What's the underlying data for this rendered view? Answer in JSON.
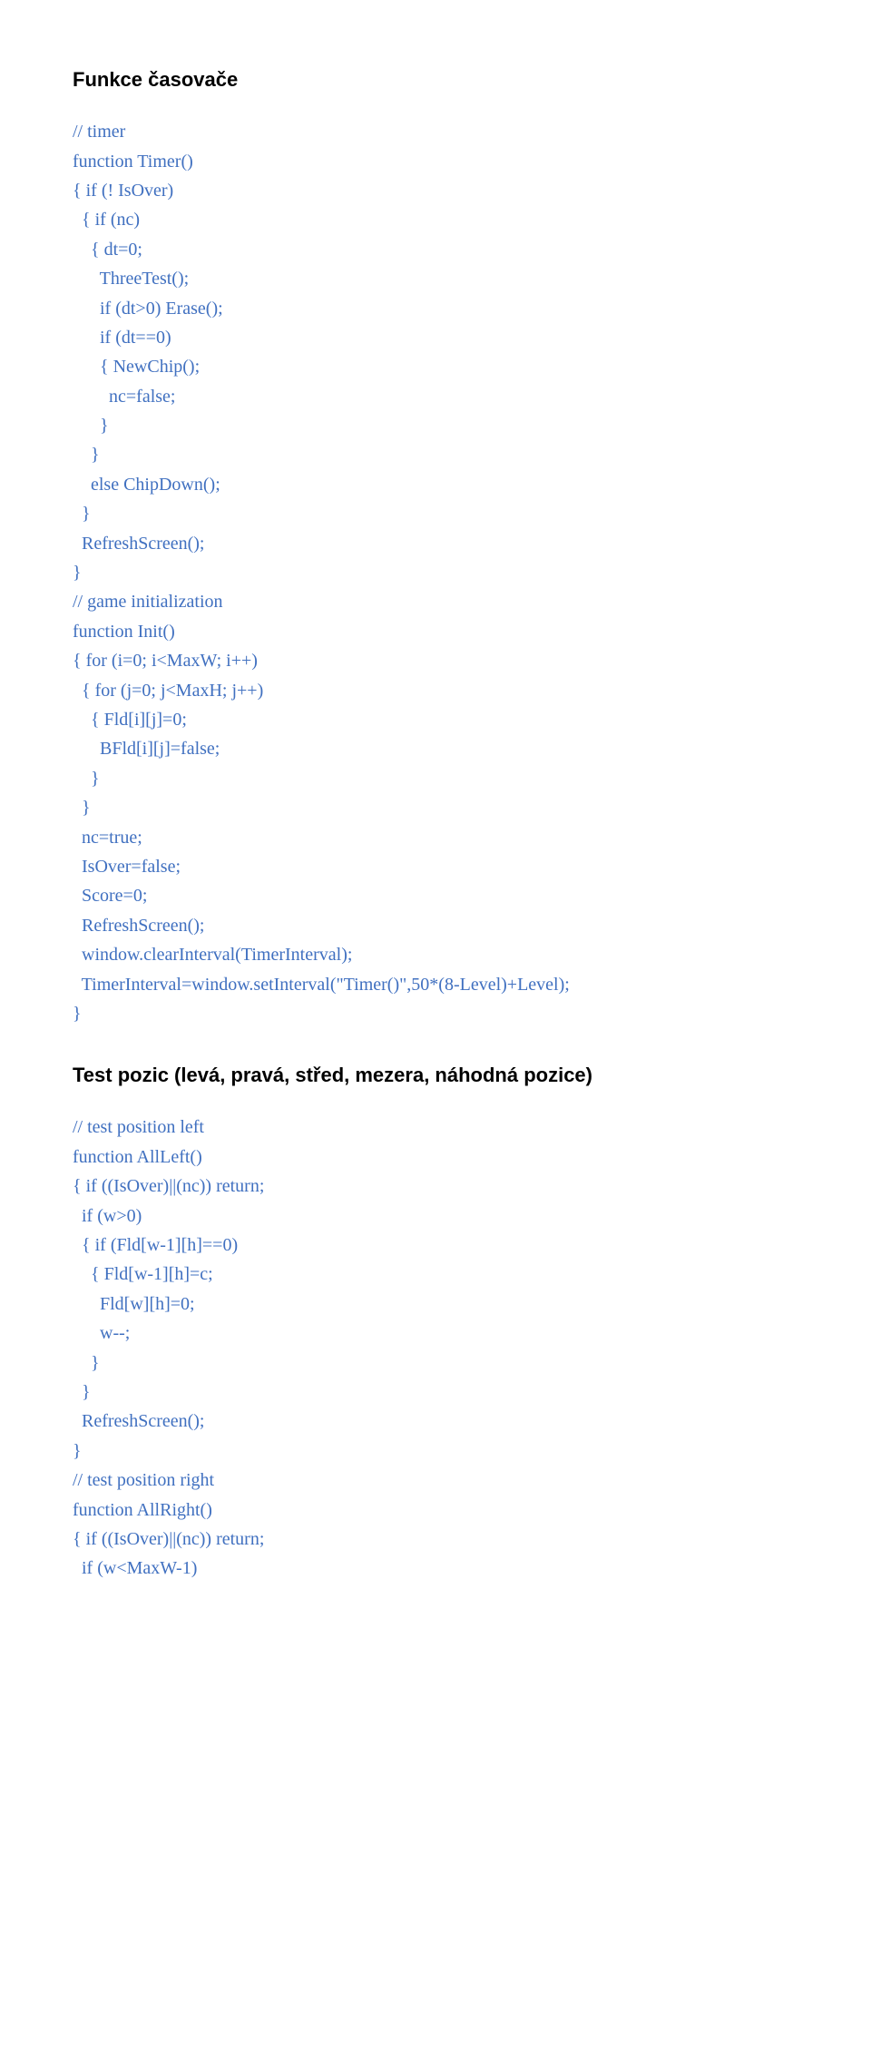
{
  "section1": {
    "heading": "Funkce časovače",
    "lines": [
      "// timer",
      "function Timer()",
      "{ if (! IsOver)",
      "  { if (nc)",
      "    { dt=0;",
      "      ThreeTest();",
      "      if (dt>0) Erase();",
      "      if (dt==0)",
      "      { NewChip();",
      "        nc=false;",
      "      }",
      "    }",
      "    else ChipDown();",
      "  }",
      "  RefreshScreen();",
      "}",
      "// game initialization",
      "function Init()",
      "{ for (i=0; i<MaxW; i++)",
      "  { for (j=0; j<MaxH; j++)",
      "    { Fld[i][j]=0;",
      "      BFld[i][j]=false;",
      "    }",
      "  }",
      "  nc=true;",
      "  IsOver=false;",
      "  Score=0;",
      "  RefreshScreen();",
      "  window.clearInterval(TimerInterval);",
      "  TimerInterval=window.setInterval(\"Timer()\",50*(8-Level)+Level);",
      "}"
    ]
  },
  "section2": {
    "heading": "Test pozic (levá, pravá, střed, mezera, náhodná pozice)",
    "lines": [
      "// test position left",
      "function AllLeft()",
      "{ if ((IsOver)||(nc)) return;",
      "  if (w>0)",
      "  { if (Fld[w-1][h]==0)",
      "    { Fld[w-1][h]=c;",
      "      Fld[w][h]=0;",
      "      w--;",
      "    }",
      "  }",
      "  RefreshScreen();",
      "}",
      "// test position right",
      "function AllRight()",
      "{ if ((IsOver)||(nc)) return;",
      "  if (w<MaxW-1)"
    ]
  }
}
